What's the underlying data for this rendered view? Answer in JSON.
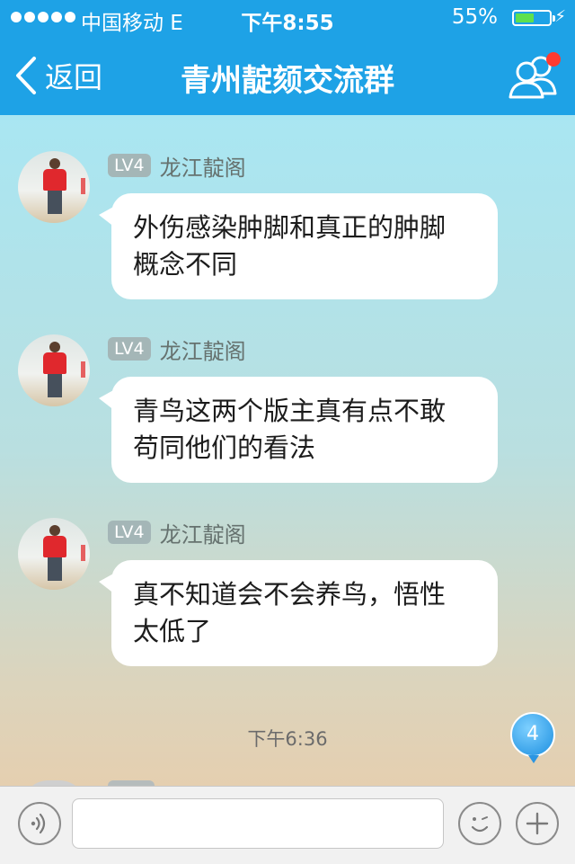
{
  "status_bar": {
    "carrier": "中国移动  E",
    "time": "下午8:55",
    "battery_percent": "55%",
    "battery_level": 0.55
  },
  "nav": {
    "back_label": "返回",
    "title": "青州靛颏交流群"
  },
  "messages": [
    {
      "badge": "LV4",
      "sender": "龙江靛阁",
      "lines": [
        "外伤感染肿脚和真正的肿脚",
        "概念不同"
      ]
    },
    {
      "badge": "LV4",
      "sender": "龙江靛阁",
      "lines": [
        "青鸟这两个版主真有点不敢",
        "苟同他们的看法"
      ]
    },
    {
      "badge": "LV4",
      "sender": "龙江靛阁",
      "lines": [
        "真不知道会不会养鸟，悟性",
        "太低了"
      ]
    }
  ],
  "timestamp": "下午6:36",
  "unread_count": "4",
  "input": {
    "value": "",
    "placeholder": ""
  },
  "colors": {
    "nav_bg": "#1ea2e6",
    "notification_dot": "#ff3b30",
    "unread_badge": "#1c8fe0"
  },
  "icons": {
    "back": "chevron-left-icon",
    "group": "group-members-icon",
    "voice": "voice-icon",
    "emoji": "emoji-icon",
    "plus": "plus-icon"
  }
}
